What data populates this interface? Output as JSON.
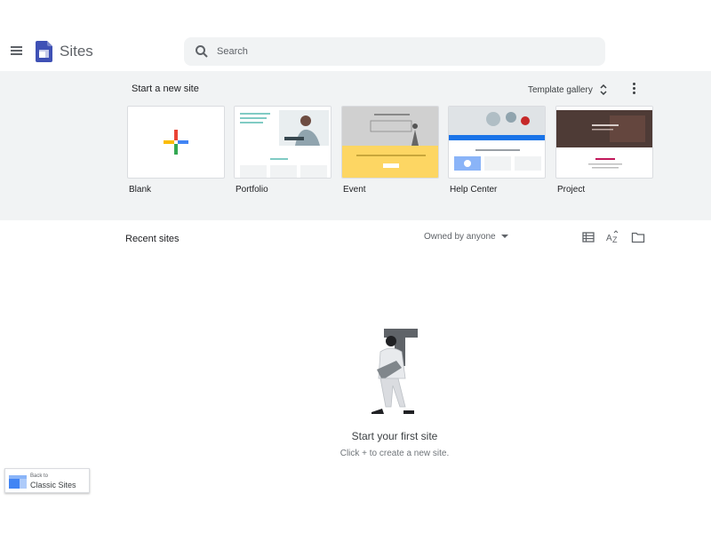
{
  "app": {
    "title": "Sites",
    "brand_color": "#3f51b5"
  },
  "search": {
    "placeholder": "Search"
  },
  "templates": {
    "section_label": "Start a new site",
    "gallery_label": "Template gallery",
    "items": [
      {
        "label": "Blank"
      },
      {
        "label": "Portfolio"
      },
      {
        "label": "Event"
      },
      {
        "label": "Help Center"
      },
      {
        "label": "Project"
      }
    ]
  },
  "recent": {
    "section_label": "Recent sites",
    "owner_filter": "Owned by anyone"
  },
  "empty_state": {
    "title": "Start your first site",
    "subtitle": "Click + to create a new site."
  },
  "classic": {
    "small_label": "Back to",
    "big_label": "Classic Sites"
  },
  "colors": {
    "header_bg": "#ffffff",
    "panel_bg": "#f1f3f4",
    "event_yellow": "#fdd663",
    "helpcenter_blue": "#1a73e8"
  },
  "icons": [
    "menu-icon",
    "sites-logo-icon",
    "search-icon",
    "unfold-icon",
    "more-vert-icon",
    "plus-icon",
    "list-view-icon",
    "sort-az-icon",
    "folder-icon"
  ]
}
